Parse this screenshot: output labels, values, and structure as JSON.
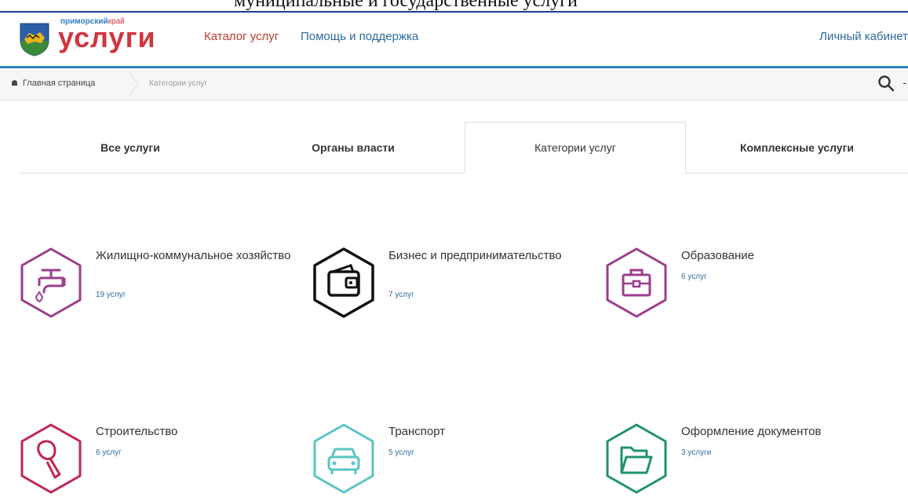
{
  "header": {
    "logo_small_blue": "приморский",
    "logo_small_red": "край",
    "logo_big": "услуги",
    "nav": {
      "catalog": "Каталог услуг",
      "help": "Помощь и поддержка",
      "cabinet": "Личный кабинет"
    }
  },
  "breadcrumb": {
    "home": "Главная страница",
    "current": "Категории услуг"
  },
  "tabs": [
    {
      "label": "Все услуги",
      "active": false
    },
    {
      "label": "Органы власти",
      "active": false
    },
    {
      "label": "Категории услуг",
      "active": true
    },
    {
      "label": "Комплексные услуги",
      "active": false
    }
  ],
  "categories": [
    {
      "title": "Жилищно-коммунальное хозяйство",
      "count": "19 услуг",
      "icon": "faucet-icon",
      "color": "#9b3d8c"
    },
    {
      "title": "Бизнес и предпринимательство",
      "count": "7 услуг",
      "icon": "wallet-icon",
      "color": "#111111"
    },
    {
      "title": "Образование",
      "count": "6 услуг",
      "icon": "briefcase-icon",
      "color": "#9b3d8c"
    },
    {
      "title": "Строительство",
      "count": "6 услуг",
      "icon": "trowel-icon",
      "color": "#c2244f"
    },
    {
      "title": "Транспорт",
      "count": "5 услуг",
      "icon": "car-icon",
      "color": "#5cc4c4"
    },
    {
      "title": "Оформление документов",
      "count": "3 услуги",
      "icon": "folder-icon",
      "color": "#1f9466"
    }
  ],
  "colors": {
    "brand_red": "#d1353e",
    "brand_blue": "#2f7fc4",
    "link_blue": "#2f6aa0"
  }
}
